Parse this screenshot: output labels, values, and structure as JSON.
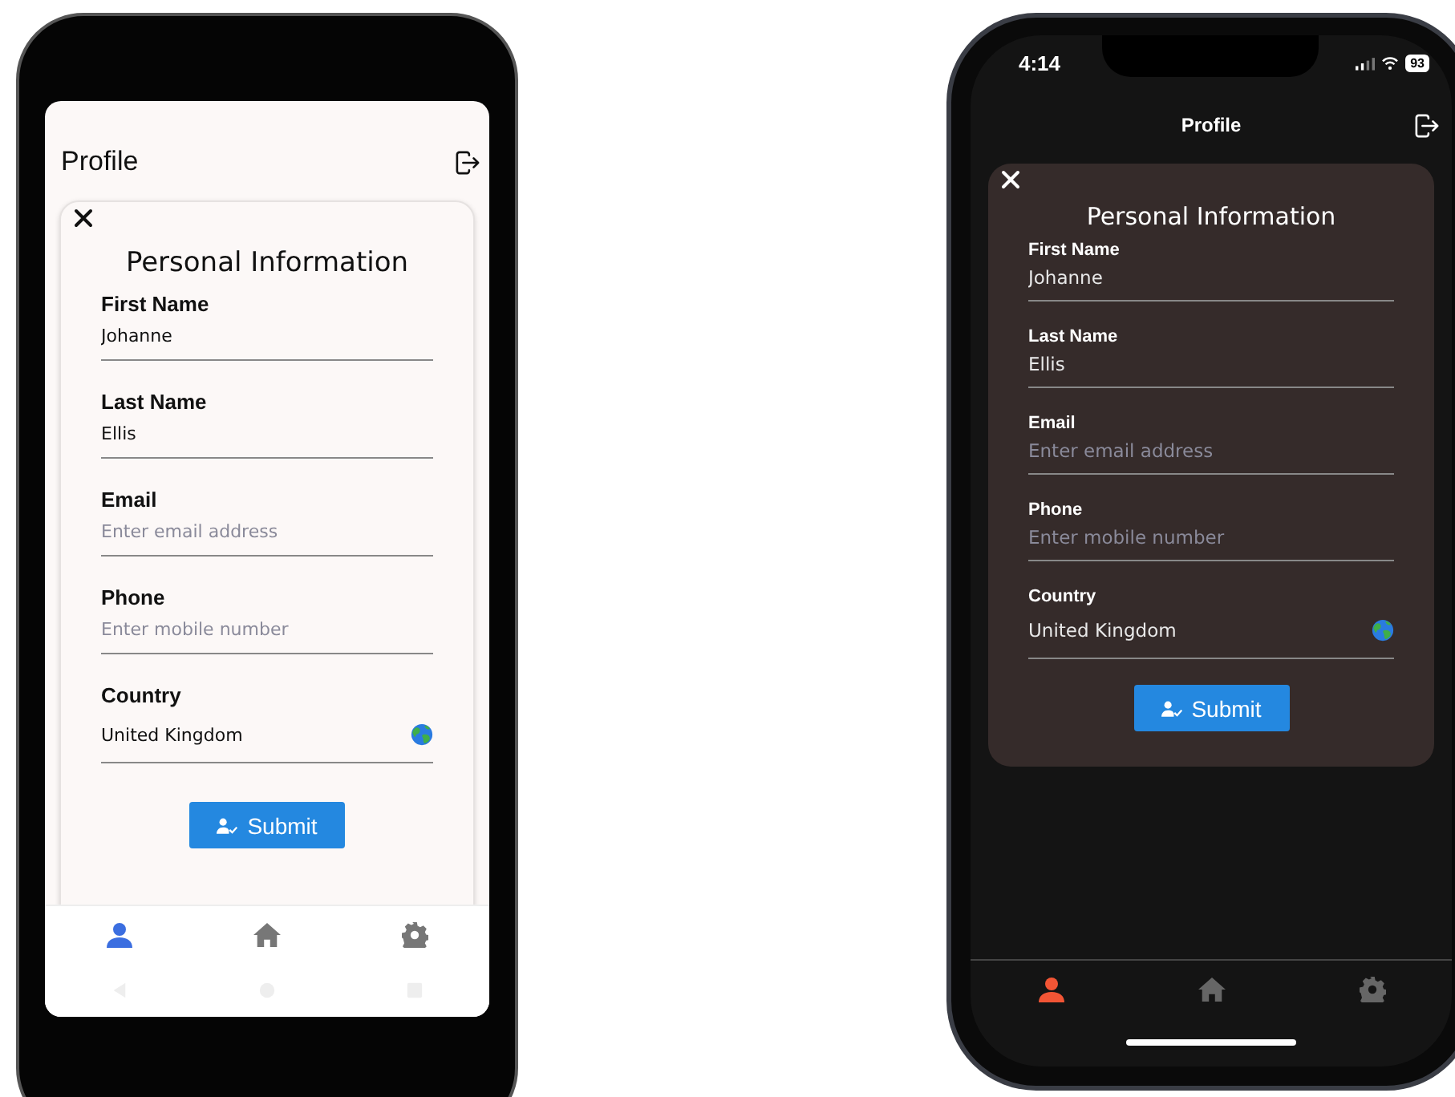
{
  "phones": [
    {
      "kind": "android",
      "header": {
        "title": "Profile"
      },
      "card": {
        "title": "Personal Information",
        "fields": [
          {
            "kind": "text",
            "label": "First Name",
            "value": "Johanne"
          },
          {
            "kind": "text",
            "label": "Last Name",
            "value": "Ellis"
          },
          {
            "kind": "text",
            "label": "Email",
            "placeholder": "Enter email address"
          },
          {
            "kind": "text",
            "label": "Phone",
            "placeholder": "Enter mobile number"
          },
          {
            "kind": "country",
            "label": "Country",
            "value": "United Kingdom"
          }
        ],
        "submit": "Submit"
      },
      "nav": [
        {
          "selected": true
        },
        {
          "selected": false
        },
        {
          "selected": false
        }
      ]
    },
    {
      "kind": "ios",
      "status_bar": {
        "time": "4:14",
        "battery": "93"
      },
      "header": {
        "title": "Profile"
      },
      "card": {
        "title": "Personal Information",
        "fields": [
          {
            "kind": "text",
            "label": "First Name",
            "value": "Johanne"
          },
          {
            "kind": "text",
            "label": "Last Name",
            "value": "Ellis"
          },
          {
            "kind": "text",
            "label": "Email",
            "placeholder": "Enter email address"
          },
          {
            "kind": "text",
            "label": "Phone",
            "placeholder": "Enter mobile number"
          },
          {
            "kind": "country",
            "label": "Country",
            "value": "United Kingdom"
          }
        ],
        "submit": "Submit"
      },
      "nav": [
        {
          "selected": true
        },
        {
          "selected": false
        },
        {
          "selected": false
        }
      ]
    }
  ]
}
